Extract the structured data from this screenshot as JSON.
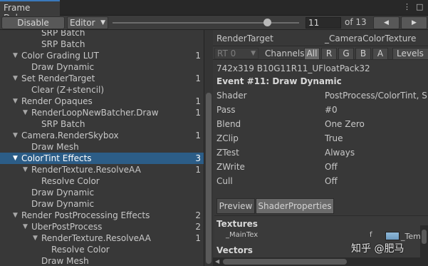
{
  "window": {
    "tab_title": "Frame Debug",
    "more_icon": "kebab-icon",
    "close_icon": "close-icon"
  },
  "toolbar": {
    "disable_label": "Disable",
    "editor_label": "Editor",
    "step_value": "11",
    "of_label": "of 13",
    "prev_icon": "◀",
    "next_icon": "▶",
    "slider_fraction": 0.83
  },
  "tree": [
    {
      "label": "SRP Batch",
      "depth": 2,
      "arrow": false,
      "count": ""
    },
    {
      "label": "SRP Batch",
      "depth": 2,
      "arrow": false,
      "count": ""
    },
    {
      "label": "Color Grading LUT",
      "depth": 0,
      "arrow": true,
      "count": "1"
    },
    {
      "label": "Draw Dynamic",
      "depth": 1,
      "arrow": false,
      "count": ""
    },
    {
      "label": "Set RenderTarget",
      "depth": 0,
      "arrow": true,
      "count": "1"
    },
    {
      "label": "Clear (Z+stencil)",
      "depth": 1,
      "arrow": false,
      "count": ""
    },
    {
      "label": "Render Opaques",
      "depth": 0,
      "arrow": true,
      "count": "1"
    },
    {
      "label": "RenderLoopNewBatcher.Draw",
      "depth": 1,
      "arrow": true,
      "count": "1"
    },
    {
      "label": "SRP Batch",
      "depth": 2,
      "arrow": false,
      "count": ""
    },
    {
      "label": "Camera.RenderSkybox",
      "depth": 0,
      "arrow": true,
      "count": "1"
    },
    {
      "label": "Draw Mesh",
      "depth": 1,
      "arrow": false,
      "count": ""
    },
    {
      "label": "ColorTint Effects",
      "depth": 0,
      "arrow": true,
      "count": "3",
      "selected": true
    },
    {
      "label": "RenderTexture.ResolveAA",
      "depth": 1,
      "arrow": true,
      "count": "1"
    },
    {
      "label": "Resolve Color",
      "depth": 2,
      "arrow": false,
      "count": ""
    },
    {
      "label": "Draw Dynamic",
      "depth": 1,
      "arrow": false,
      "count": ""
    },
    {
      "label": "Draw Dynamic",
      "depth": 1,
      "arrow": false,
      "count": ""
    },
    {
      "label": "Render PostProcessing Effects",
      "depth": 0,
      "arrow": true,
      "count": "2"
    },
    {
      "label": "UberPostProcess",
      "depth": 1,
      "arrow": true,
      "count": "2"
    },
    {
      "label": "RenderTexture.ResolveAA",
      "depth": 2,
      "arrow": true,
      "count": "1"
    },
    {
      "label": "Resolve Color",
      "depth": 3,
      "arrow": false,
      "count": ""
    },
    {
      "label": "Draw Mesh",
      "depth": 2,
      "arrow": false,
      "count": ""
    }
  ],
  "detail": {
    "render_target_label": "RenderTarget",
    "render_target_value": "_CameraColorTexture",
    "rt_dropdown": "RT 0",
    "channels_label": "Channels",
    "channels": [
      "All",
      "R",
      "G",
      "B",
      "A"
    ],
    "levels_label": "Levels",
    "format": "742x319 B10G11R11_UFloatPack32",
    "event_title": "Event #11: Draw Dynamic",
    "props": [
      {
        "key": "Shader",
        "value": "PostProcess/ColorTint, S"
      },
      {
        "key": "Pass",
        "value": "#0"
      },
      {
        "key": "Blend",
        "value": "One Zero"
      },
      {
        "key": "ZClip",
        "value": "True"
      },
      {
        "key": "ZTest",
        "value": "Always"
      },
      {
        "key": "ZWrite",
        "value": "Off"
      },
      {
        "key": "Cull",
        "value": "Off"
      }
    ],
    "preview_tab": "Preview",
    "shader_props_tab": "ShaderProperties",
    "textures_heading": "Textures",
    "texture_name": "_MainTex",
    "texture_stage": "f",
    "texture_value": "_Tem",
    "vectors_heading": "Vectors"
  },
  "watermark": "知乎 @肥马"
}
